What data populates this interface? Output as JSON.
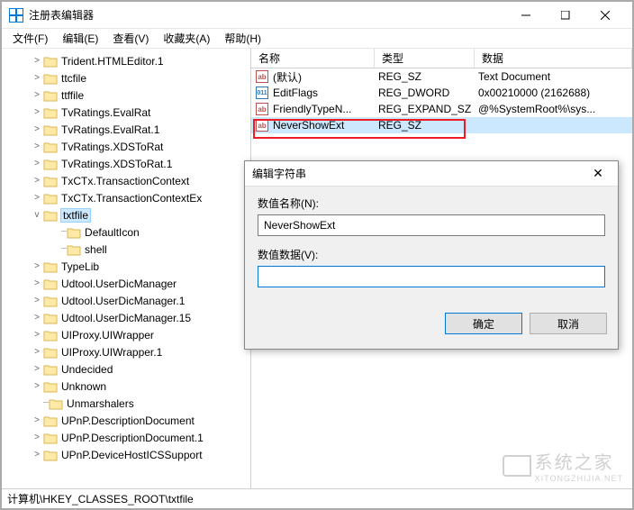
{
  "window": {
    "title": "注册表编辑器"
  },
  "menu": {
    "file": "文件(F)",
    "edit": "编辑(E)",
    "view": "查看(V)",
    "favorites": "收藏夹(A)",
    "help": "帮助(H)"
  },
  "tree": {
    "items": [
      {
        "indent": 0,
        "expander": ">",
        "label": "Trident.HTMLEditor.1"
      },
      {
        "indent": 0,
        "expander": ">",
        "label": "ttcfile"
      },
      {
        "indent": 0,
        "expander": ">",
        "label": "ttffile"
      },
      {
        "indent": 0,
        "expander": ">",
        "label": "TvRatings.EvalRat"
      },
      {
        "indent": 0,
        "expander": ">",
        "label": "TvRatings.EvalRat.1"
      },
      {
        "indent": 0,
        "expander": ">",
        "label": "TvRatings.XDSToRat"
      },
      {
        "indent": 0,
        "expander": ">",
        "label": "TvRatings.XDSToRat.1"
      },
      {
        "indent": 0,
        "expander": ">",
        "label": "TxCTx.TransactionContext"
      },
      {
        "indent": 0,
        "expander": ">",
        "label": "TxCTx.TransactionContextEx"
      },
      {
        "indent": 0,
        "expander": "v",
        "label": "txtfile",
        "selected": true
      },
      {
        "indent": 1,
        "expander": "",
        "label": "DefaultIcon",
        "dots": true
      },
      {
        "indent": 1,
        "expander": "",
        "label": "shell",
        "dots": true
      },
      {
        "indent": 0,
        "expander": ">",
        "label": "TypeLib"
      },
      {
        "indent": 0,
        "expander": ">",
        "label": "Udtool.UserDicManager"
      },
      {
        "indent": 0,
        "expander": ">",
        "label": "Udtool.UserDicManager.1"
      },
      {
        "indent": 0,
        "expander": ">",
        "label": "Udtool.UserDicManager.15"
      },
      {
        "indent": 0,
        "expander": ">",
        "label": "UIProxy.UIWrapper"
      },
      {
        "indent": 0,
        "expander": ">",
        "label": "UIProxy.UIWrapper.1"
      },
      {
        "indent": 0,
        "expander": ">",
        "label": "Undecided"
      },
      {
        "indent": 0,
        "expander": ">",
        "label": "Unknown"
      },
      {
        "indent": 0,
        "expander": "",
        "label": "Unmarshalers",
        "dots": true
      },
      {
        "indent": 0,
        "expander": ">",
        "label": "UPnP.DescriptionDocument"
      },
      {
        "indent": 0,
        "expander": ">",
        "label": "UPnP.DescriptionDocument.1"
      },
      {
        "indent": 0,
        "expander": ">",
        "label": "UPnP.DeviceHostICSSupport"
      }
    ]
  },
  "columns": {
    "name": "名称",
    "type": "类型",
    "data": "数据"
  },
  "values": [
    {
      "icon": "ab",
      "name": "(默认)",
      "type": "REG_SZ",
      "data": "Text Document"
    },
    {
      "icon": "bin",
      "name": "EditFlags",
      "type": "REG_DWORD",
      "data": "0x00210000 (2162688)"
    },
    {
      "icon": "ab",
      "name": "FriendlyTypeN...",
      "type": "REG_EXPAND_SZ",
      "data": "@%SystemRoot%\\sys..."
    },
    {
      "icon": "ab",
      "name": "NeverShowExt",
      "type": "REG_SZ",
      "data": "",
      "selected": true
    }
  ],
  "status": {
    "path": "计算机\\HKEY_CLASSES_ROOT\\txtfile"
  },
  "dialog": {
    "title": "编辑字符串",
    "name_label": "数值名称(N):",
    "name_value": "NeverShowExt",
    "data_label": "数值数据(V):",
    "data_value": "",
    "ok": "确定",
    "cancel": "取消"
  },
  "watermark": {
    "text": "系统之家",
    "url": "XITONGZHIJIA.NET"
  }
}
